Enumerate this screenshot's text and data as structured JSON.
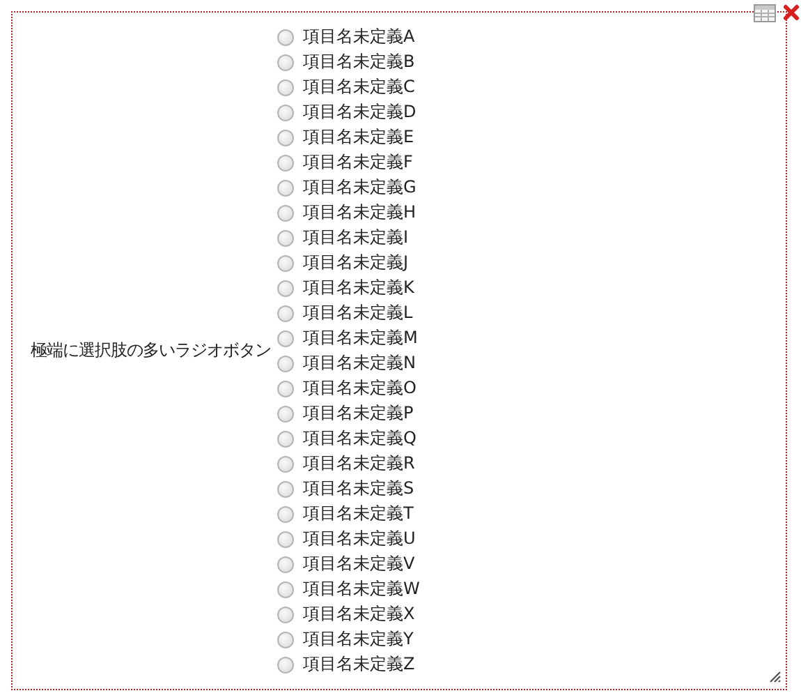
{
  "field": {
    "label": "極端に選択肢の多いラジオボタン",
    "options": [
      {
        "label": "項目名未定義A",
        "selected": false
      },
      {
        "label": "項目名未定義B",
        "selected": false
      },
      {
        "label": "項目名未定義C",
        "selected": false
      },
      {
        "label": "項目名未定義D",
        "selected": false
      },
      {
        "label": "項目名未定義E",
        "selected": false
      },
      {
        "label": "項目名未定義F",
        "selected": false
      },
      {
        "label": "項目名未定義G",
        "selected": false
      },
      {
        "label": "項目名未定義H",
        "selected": false
      },
      {
        "label": "項目名未定義I",
        "selected": false
      },
      {
        "label": "項目名未定義J",
        "selected": false
      },
      {
        "label": "項目名未定義K",
        "selected": false
      },
      {
        "label": "項目名未定義L",
        "selected": false
      },
      {
        "label": "項目名未定義M",
        "selected": false
      },
      {
        "label": "項目名未定義N",
        "selected": false
      },
      {
        "label": "項目名未定義O",
        "selected": false
      },
      {
        "label": "項目名未定義P",
        "selected": false
      },
      {
        "label": "項目名未定義Q",
        "selected": false
      },
      {
        "label": "項目名未定義R",
        "selected": false
      },
      {
        "label": "項目名未定義S",
        "selected": false
      },
      {
        "label": "項目名未定義T",
        "selected": false
      },
      {
        "label": "項目名未定義U",
        "selected": false
      },
      {
        "label": "項目名未定義V",
        "selected": false
      },
      {
        "label": "項目名未定義W",
        "selected": false
      },
      {
        "label": "項目名未定義X",
        "selected": false
      },
      {
        "label": "項目名未定義Y",
        "selected": false
      },
      {
        "label": "項目名未定義Z",
        "selected": false
      }
    ]
  }
}
